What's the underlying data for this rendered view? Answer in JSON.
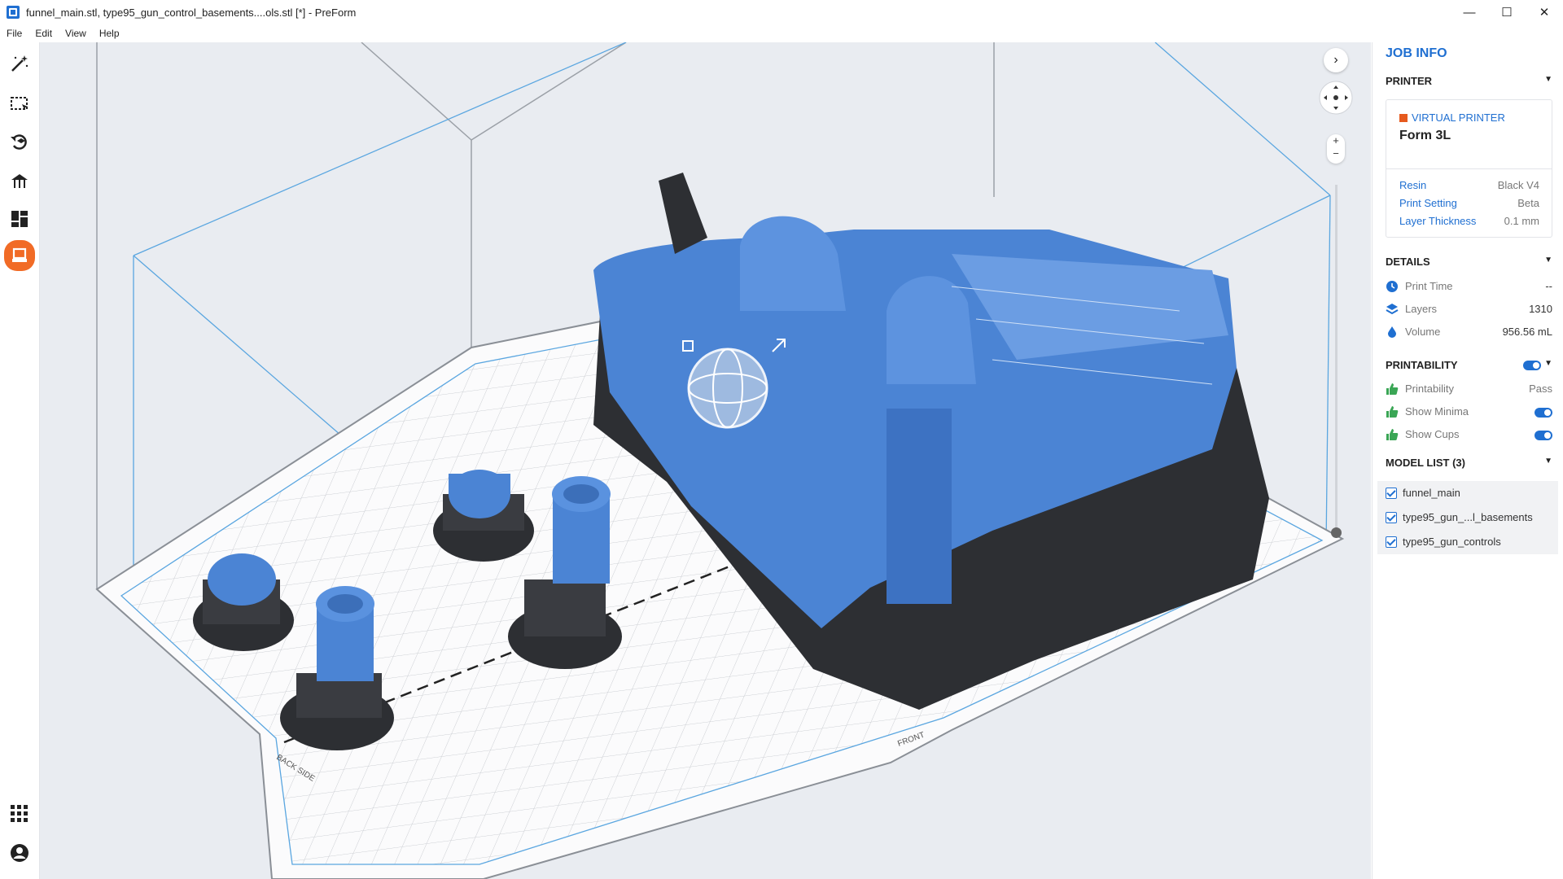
{
  "window": {
    "title": "funnel_main.stl, type95_gun_control_basements....ols.stl [*] - PreForm",
    "minimize": "—",
    "maximize": "☐",
    "close": "✕"
  },
  "menu": [
    "File",
    "Edit",
    "View",
    "Help"
  ],
  "toolbar": {
    "tools": [
      "magic-wand-icon",
      "selection-icon",
      "orient-icon",
      "supports-icon",
      "layout-icon",
      "print-icon"
    ],
    "active": "print-icon",
    "accent": "#f16b26",
    "bottom": [
      "apps-grid-icon",
      "account-icon"
    ]
  },
  "viewport": {
    "background": "#e9ecf1",
    "model_color": "#4b84d4",
    "support_color": "#2d2f33",
    "front_label": "FRONT",
    "side_label": "BACK SIDE",
    "nav_next": "›"
  },
  "panel": {
    "title": "JOB INFO",
    "printer": {
      "heading": "PRINTER",
      "type": "VIRTUAL PRINTER",
      "model": "Form 3L",
      "resin_label": "Resin",
      "resin_value": "Black V4",
      "setting_label": "Print Setting",
      "setting_value": "Beta",
      "thickness_label": "Layer Thickness",
      "thickness_value": "0.1 mm"
    },
    "details": {
      "heading": "DETAILS",
      "print_time_label": "Print Time",
      "print_time_value": "--",
      "layers_label": "Layers",
      "layers_value": "1310",
      "volume_label": "Volume",
      "volume_value": "956.56 mL"
    },
    "printability": {
      "heading": "PRINTABILITY",
      "printability_label": "Printability",
      "printability_value": "Pass",
      "minima_label": "Show Minima",
      "cups_label": "Show Cups"
    },
    "models": {
      "heading": "MODEL LIST (3)",
      "items": [
        "funnel_main",
        "type95_gun_...l_basements",
        "type95_gun_controls"
      ]
    },
    "accent": "#1f6fd1"
  }
}
